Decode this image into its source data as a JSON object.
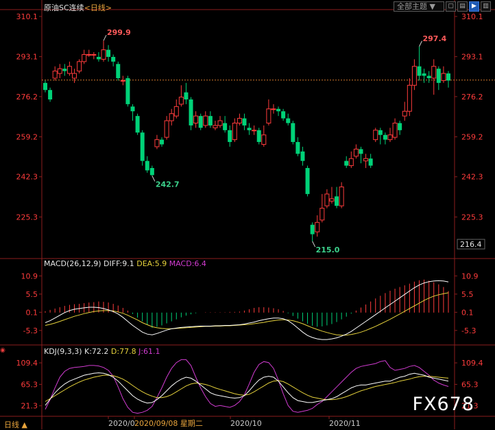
{
  "header": {
    "instrument": "原油SC连续",
    "period": "<日线>",
    "theme_button": "全部主题",
    "theme_arrow": "▼"
  },
  "price_panel": {
    "y_ticks": [
      "310.1",
      "293.1",
      "276.2",
      "259.2",
      "242.3",
      "225.3"
    ],
    "current_price": "216.4",
    "reference_line": 283.2
  },
  "macd_panel": {
    "label": "MACD(26,12,9)",
    "diff": "DIFF:9.1",
    "dea": "DEA:5.9",
    "macd": "MACD:6.4",
    "y_ticks": [
      "10.9",
      "5.5",
      "0.1",
      "-5.3"
    ]
  },
  "kdj_panel": {
    "label": "KDJ(9,3,3)",
    "k": "K:72.2",
    "d": "D:77.8",
    "j": "J:61.1",
    "y_ticks": [
      "109.4",
      "65.3",
      "21.3"
    ]
  },
  "x_axis": {
    "labels": [
      "2020/0",
      "2020/09/08 星期二",
      "2020/10",
      "2020/11"
    ]
  },
  "footer": {
    "period_tab": "日线 ▲",
    "watermark": "FX678"
  },
  "colors": {
    "up": "#ff3c3c",
    "down": "#00d278",
    "axis": "#8c1e1e",
    "diff": "#ffffff",
    "dea": "#e6d23c",
    "j": "#d23cd2",
    "annotation_high": "#ff5a5a",
    "annotation_low": "#3cd28c"
  },
  "chart_data": {
    "type": "candlestick",
    "ylim": [
      208,
      313
    ],
    "annotations": [
      {
        "text": "299.9",
        "index": 12,
        "value": 299.9,
        "kind": "high"
      },
      {
        "text": "242.7",
        "index": 22,
        "value": 242.7,
        "kind": "low"
      },
      {
        "text": "215.0",
        "index": 55,
        "value": 215.0,
        "kind": "low"
      },
      {
        "text": "297.4",
        "index": 77,
        "value": 297.4,
        "kind": "high"
      }
    ],
    "candles": [
      [
        282,
        279,
        283,
        278
      ],
      [
        279,
        275,
        280,
        274
      ],
      [
        284,
        287,
        289,
        283
      ],
      [
        286,
        288,
        290,
        284
      ],
      [
        288,
        287,
        290,
        285
      ],
      [
        286,
        289,
        291,
        285
      ],
      [
        284,
        286,
        288,
        282
      ],
      [
        287,
        291,
        292,
        286
      ],
      [
        291,
        294,
        296,
        290
      ],
      [
        294,
        294,
        296,
        293
      ],
      [
        294,
        294,
        295,
        292
      ],
      [
        293,
        292,
        295,
        291
      ],
      [
        292,
        296,
        299.9,
        291
      ],
      [
        296,
        293,
        298,
        291
      ],
      [
        293,
        291,
        294,
        289
      ],
      [
        290,
        284,
        291,
        283
      ],
      [
        283,
        283,
        285,
        281
      ],
      [
        284,
        273,
        285,
        272
      ],
      [
        272,
        270,
        273,
        266
      ],
      [
        268,
        261,
        269,
        260
      ],
      [
        261,
        249,
        262,
        247
      ],
      [
        249,
        245,
        251,
        244
      ],
      [
        246,
        243,
        247,
        242.7
      ],
      [
        255,
        258,
        260,
        254
      ],
      [
        258,
        256,
        259,
        255
      ],
      [
        259,
        266,
        268,
        258
      ],
      [
        266,
        269,
        271,
        264
      ],
      [
        268,
        272,
        275,
        267
      ],
      [
        273,
        276,
        281,
        272
      ],
      [
        278,
        275,
        282,
        273
      ],
      [
        275,
        264,
        276,
        262
      ],
      [
        265,
        268,
        270,
        263
      ],
      [
        268,
        263,
        269,
        262
      ],
      [
        264,
        268,
        270,
        263
      ],
      [
        268,
        264,
        270,
        263
      ],
      [
        263,
        264,
        266,
        262
      ],
      [
        264,
        266,
        268,
        263
      ],
      [
        265,
        262,
        268,
        261
      ],
      [
        262,
        257,
        264,
        255
      ],
      [
        258,
        265,
        267,
        257
      ],
      [
        265,
        267,
        269,
        264
      ],
      [
        267,
        264,
        269,
        262
      ],
      [
        263,
        262,
        265,
        260
      ],
      [
        262,
        262,
        264,
        260
      ],
      [
        262,
        257,
        263,
        256
      ],
      [
        256,
        260,
        264,
        255
      ],
      [
        265,
        271,
        275,
        264
      ],
      [
        271,
        271,
        273,
        269
      ],
      [
        271,
        270,
        272,
        268
      ],
      [
        270,
        267,
        271,
        266
      ],
      [
        267,
        265,
        269,
        264
      ],
      [
        265,
        257,
        266,
        256
      ],
      [
        257,
        252,
        259,
        251
      ],
      [
        253,
        249,
        255,
        247
      ],
      [
        246,
        235,
        247,
        234
      ],
      [
        222,
        218,
        223,
        215
      ],
      [
        219,
        223,
        226,
        217
      ],
      [
        224,
        229,
        235,
        223
      ],
      [
        230,
        235,
        237,
        229
      ],
      [
        232,
        233,
        238,
        231
      ],
      [
        234,
        230,
        238,
        229
      ],
      [
        230,
        238,
        240,
        229
      ],
      [
        249,
        247,
        251,
        246
      ],
      [
        247,
        250,
        253,
        246
      ],
      [
        251,
        254,
        256,
        250
      ],
      [
        254,
        252,
        255,
        248
      ],
      [
        249,
        250,
        252,
        246
      ],
      [
        250,
        247,
        252,
        246
      ],
      [
        258,
        262,
        263,
        257
      ],
      [
        262,
        260,
        263,
        256
      ],
      [
        260,
        258,
        261,
        256
      ],
      [
        258,
        260,
        263,
        257
      ],
      [
        259,
        265,
        267,
        258
      ],
      [
        265,
        262,
        266,
        260
      ],
      [
        268,
        270,
        274,
        266
      ],
      [
        270,
        281,
        284,
        268
      ],
      [
        281,
        289,
        292,
        279
      ],
      [
        289,
        285,
        297.4,
        283
      ],
      [
        286,
        285,
        288,
        282
      ],
      [
        285,
        284,
        287,
        282
      ],
      [
        284,
        289,
        292,
        277
      ],
      [
        288,
        282,
        289,
        279
      ],
      [
        283,
        286,
        289,
        282
      ],
      [
        286,
        283,
        287,
        280
      ]
    ],
    "macd_ylim": [
      -9,
      13
    ],
    "macd_hist": [
      0.4,
      0.8,
      1.2,
      1.6,
      2.0,
      2.3,
      2.5,
      2.6,
      2.8,
      3.0,
      3.1,
      3.3,
      3.2,
      3.0,
      2.6,
      2.1,
      1.4,
      0.6,
      -0.4,
      -1.5,
      -2.6,
      -3.6,
      -4.5,
      -4.2,
      -3.8,
      -3.2,
      -2.6,
      -2.0,
      -1.4,
      -0.9,
      -0.5,
      -0.2,
      0.0,
      0.1,
      0.1,
      0.1,
      0.1,
      0.1,
      0.2,
      0.2,
      0.3,
      0.6,
      1.0,
      1.4,
      1.6,
      1.6,
      1.5,
      1.3,
      1.0,
      0.5,
      -0.2,
      -1.0,
      -1.8,
      -2.6,
      -3.3,
      -3.9,
      -4.2,
      -4.1,
      -3.8,
      -3.4,
      -2.8,
      -2.0,
      -1.2,
      -0.3,
      0.6,
      1.5,
      2.4,
      3.3,
      4.2,
      5.0,
      5.8,
      6.5,
      7.1,
      7.6,
      8.1,
      8.6,
      9.2,
      9.6,
      9.8,
      9.5,
      9.0,
      8.4,
      7.6,
      6.4
    ],
    "macd_diff": [
      -3.0,
      -2.4,
      -1.6,
      -0.8,
      0.0,
      0.6,
      1.0,
      1.2,
      1.4,
      1.6,
      1.6,
      1.5,
      1.2,
      0.8,
      0.3,
      -0.4,
      -1.4,
      -2.6,
      -3.8,
      -4.8,
      -5.8,
      -6.4,
      -6.6,
      -6.2,
      -5.7,
      -5.2,
      -4.8,
      -4.6,
      -4.4,
      -4.3,
      -4.2,
      -4.1,
      -4.0,
      -4.0,
      -4.0,
      -3.9,
      -3.9,
      -3.8,
      -3.8,
      -3.7,
      -3.6,
      -3.4,
      -3.1,
      -2.8,
      -2.4,
      -2.1,
      -1.8,
      -1.6,
      -1.6,
      -1.8,
      -2.4,
      -3.4,
      -4.6,
      -5.8,
      -6.8,
      -7.4,
      -7.8,
      -8.0,
      -8.0,
      -7.8,
      -7.5,
      -7.0,
      -6.4,
      -5.6,
      -4.6,
      -3.6,
      -2.6,
      -1.6,
      -0.6,
      0.4,
      1.4,
      2.4,
      3.4,
      4.4,
      5.4,
      6.4,
      7.4,
      8.2,
      8.8,
      9.2,
      9.4,
      9.5,
      9.4,
      9.1
    ],
    "macd_dea": [
      -3.8,
      -3.5,
      -3.1,
      -2.6,
      -2.1,
      -1.6,
      -1.1,
      -0.7,
      -0.3,
      0.0,
      0.3,
      0.5,
      0.6,
      0.6,
      0.5,
      0.2,
      -0.2,
      -0.8,
      -1.5,
      -2.2,
      -3.0,
      -3.6,
      -4.2,
      -4.5,
      -4.7,
      -4.8,
      -4.8,
      -4.7,
      -4.6,
      -4.5,
      -4.4,
      -4.3,
      -4.2,
      -4.1,
      -4.1,
      -4.0,
      -4.0,
      -3.9,
      -3.9,
      -3.8,
      -3.7,
      -3.6,
      -3.5,
      -3.3,
      -3.1,
      -2.9,
      -2.6,
      -2.4,
      -2.2,
      -2.1,
      -2.2,
      -2.4,
      -2.8,
      -3.3,
      -3.9,
      -4.5,
      -5.0,
      -5.5,
      -5.9,
      -6.3,
      -6.6,
      -6.7,
      -6.7,
      -6.5,
      -6.2,
      -5.8,
      -5.3,
      -4.7,
      -4.1,
      -3.4,
      -2.7,
      -2.0,
      -1.2,
      -0.4,
      0.4,
      1.2,
      2.0,
      2.8,
      3.6,
      4.3,
      4.9,
      5.3,
      5.6,
      5.9
    ],
    "kdj_ylim": [
      4,
      125
    ],
    "kdj_k": [
      22,
      35,
      48,
      58,
      66,
      72,
      76,
      80,
      84,
      86,
      88,
      89,
      88,
      85,
      80,
      72,
      62,
      52,
      42,
      35,
      30,
      27,
      28,
      34,
      42,
      52,
      62,
      70,
      76,
      80,
      78,
      72,
      64,
      56,
      48,
      44,
      42,
      40,
      38,
      37,
      38,
      42,
      52,
      64,
      74,
      80,
      82,
      80,
      72,
      60,
      48,
      38,
      32,
      30,
      28,
      28,
      30,
      32,
      34,
      36,
      40,
      46,
      52,
      58,
      62,
      64,
      64,
      66,
      68,
      70,
      72,
      72,
      76,
      80,
      82,
      86,
      88,
      86,
      84,
      80,
      78,
      76,
      74,
      72
    ],
    "kdj_d": [
      30,
      36,
      42,
      48,
      54,
      60,
      65,
      70,
      74,
      77,
      80,
      82,
      84,
      84,
      83,
      80,
      76,
      70,
      63,
      56,
      50,
      45,
      41,
      38,
      38,
      40,
      44,
      50,
      56,
      62,
      66,
      68,
      67,
      65,
      62,
      58,
      55,
      52,
      49,
      46,
      44,
      43,
      45,
      50,
      56,
      62,
      68,
      72,
      73,
      71,
      66,
      60,
      54,
      48,
      43,
      39,
      37,
      35,
      34,
      34,
      35,
      37,
      40,
      44,
      48,
      52,
      55,
      58,
      61,
      63,
      65,
      67,
      69,
      72,
      74,
      76,
      79,
      81,
      82,
      82,
      81,
      80,
      79,
      78
    ],
    "kdj_j": [
      14,
      34,
      58,
      80,
      92,
      98,
      100,
      101,
      102,
      104,
      104,
      103,
      100,
      94,
      82,
      60,
      36,
      18,
      8,
      6,
      8,
      12,
      20,
      38,
      58,
      80,
      98,
      110,
      116,
      116,
      104,
      80,
      58,
      40,
      26,
      20,
      22,
      20,
      18,
      22,
      30,
      44,
      66,
      90,
      106,
      112,
      110,
      98,
      74,
      46,
      22,
      10,
      8,
      10,
      12,
      16,
      24,
      30,
      40,
      50,
      60,
      70,
      80,
      90,
      98,
      102,
      104,
      106,
      108,
      112,
      114,
      100,
      94,
      96,
      98,
      102,
      104,
      100,
      92,
      84,
      74,
      68,
      64,
      61
    ]
  }
}
